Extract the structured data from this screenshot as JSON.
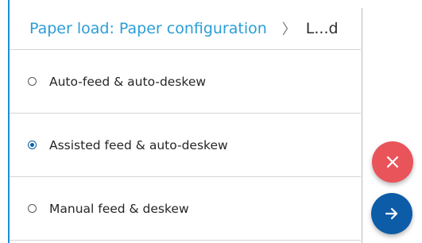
{
  "breadcrumb": {
    "link_label": "Paper load: Paper configuration",
    "separator": "〉",
    "current_label": "L...d"
  },
  "options": [
    {
      "label": "Auto-feed & auto-deskew",
      "selected": false
    },
    {
      "label": "Assisted feed & auto-deskew",
      "selected": true
    },
    {
      "label": "Manual feed & deskew",
      "selected": false
    }
  ],
  "actions": {
    "cancel_icon": "close-icon",
    "next_icon": "arrow-right-icon"
  },
  "colors": {
    "accent": "#2a9dd6",
    "radio_selected": "#0c5fa8",
    "cancel_button": "#e9545a",
    "next_button": "#0d5ca7"
  }
}
